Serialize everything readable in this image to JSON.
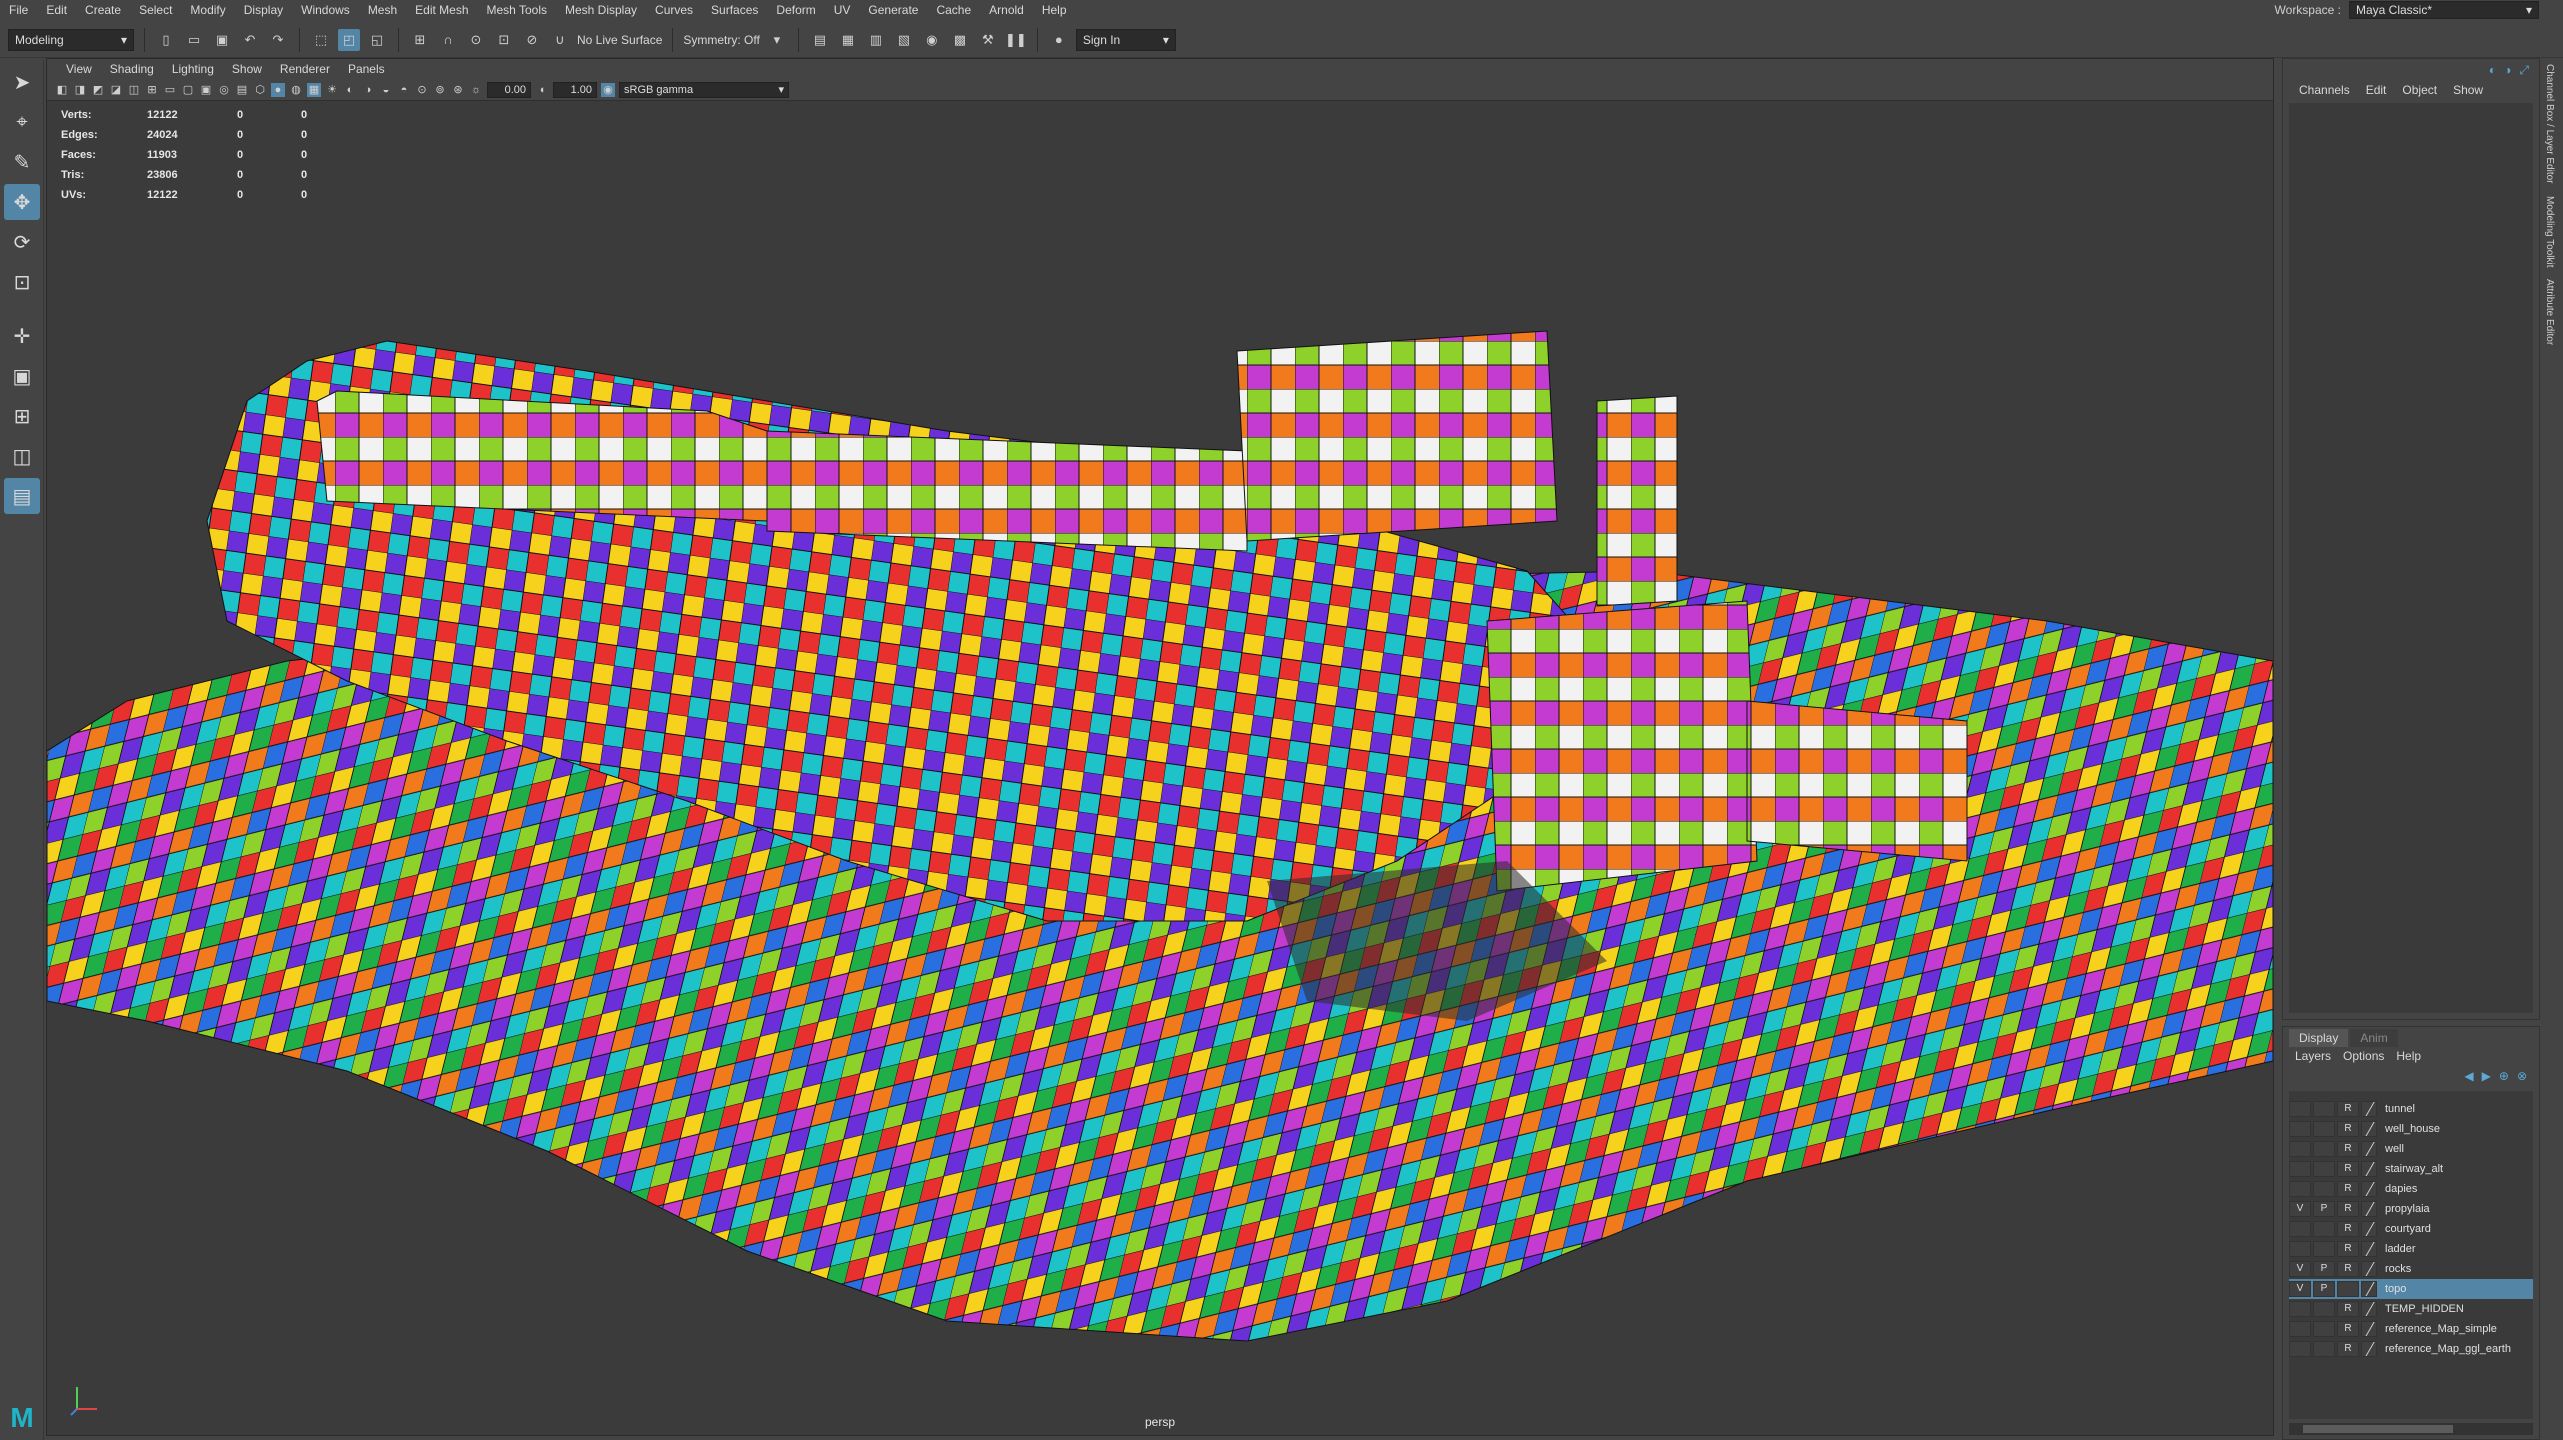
{
  "menubar": {
    "items": [
      "File",
      "Edit",
      "Create",
      "Select",
      "Modify",
      "Display",
      "Windows",
      "Mesh",
      "Edit Mesh",
      "Mesh Tools",
      "Mesh Display",
      "Curves",
      "Surfaces",
      "Deform",
      "UV",
      "Generate",
      "Cache",
      "Arnold",
      "Help"
    ],
    "workspace_label": "Workspace :",
    "workspace_value": "Maya Classic*"
  },
  "statusline": {
    "menuset": "Modeling",
    "live_surface": "No Live Surface",
    "symmetry": "Symmetry: Off",
    "sign_in": "Sign In"
  },
  "viewport": {
    "menu": [
      "View",
      "Shading",
      "Lighting",
      "Show",
      "Renderer",
      "Panels"
    ],
    "exposure": "0.00",
    "gamma": "1.00",
    "color_space": "sRGB gamma",
    "camera": "persp",
    "hud": [
      {
        "label": "Verts:",
        "value": "12122",
        "a": "0",
        "b": "0"
      },
      {
        "label": "Edges:",
        "value": "24024",
        "a": "0",
        "b": "0"
      },
      {
        "label": "Faces:",
        "value": "11903",
        "a": "0",
        "b": "0"
      },
      {
        "label": "Tris:",
        "value": "23806",
        "a": "0",
        "b": "0"
      },
      {
        "label": "UVs:",
        "value": "12122",
        "a": "0",
        "b": "0"
      }
    ]
  },
  "channelbox": {
    "menu": [
      "Channels",
      "Edit",
      "Object",
      "Show"
    ]
  },
  "side_tabs": [
    "Channel Box / Layer Editor",
    "Modeling Toolkit",
    "Attribute Editor"
  ],
  "layer_editor": {
    "tabs": [
      "Display",
      "Anim"
    ],
    "menu": [
      "Layers",
      "Options",
      "Help"
    ],
    "layers": [
      {
        "v": "",
        "p": "",
        "r": "R",
        "name": "tunnel",
        "selected": false
      },
      {
        "v": "",
        "p": "",
        "r": "R",
        "name": "well_house",
        "selected": false
      },
      {
        "v": "",
        "p": "",
        "r": "R",
        "name": "well",
        "selected": false
      },
      {
        "v": "",
        "p": "",
        "r": "R",
        "name": "stairway_alt",
        "selected": false
      },
      {
        "v": "",
        "p": "",
        "r": "R",
        "name": "dapies",
        "selected": false
      },
      {
        "v": "V",
        "p": "P",
        "r": "R",
        "name": "propylaia",
        "selected": false
      },
      {
        "v": "",
        "p": "",
        "r": "R",
        "name": "courtyard",
        "selected": false
      },
      {
        "v": "",
        "p": "",
        "r": "R",
        "name": "ladder",
        "selected": false
      },
      {
        "v": "V",
        "p": "P",
        "r": "R",
        "name": "rocks",
        "selected": false
      },
      {
        "v": "V",
        "p": "P",
        "r": "",
        "name": "topo",
        "selected": true
      },
      {
        "v": "",
        "p": "",
        "r": "R",
        "name": "TEMP_HIDDEN",
        "selected": false
      },
      {
        "v": "",
        "p": "",
        "r": "R",
        "name": "reference_Map_simple",
        "selected": false
      },
      {
        "v": "",
        "p": "",
        "r": "R",
        "name": "reference_Map_ggl_earth",
        "selected": false
      }
    ]
  },
  "colors": {
    "ui_bg": "#444444",
    "accent": "#5285a6",
    "viewport_bg": "#3b3b3b",
    "checker": [
      "#e8302f",
      "#f07a1c",
      "#f6d21c",
      "#8fd12b",
      "#1fae48",
      "#1ec3c9",
      "#2a6fe0",
      "#6a2fd8",
      "#c43bd1",
      "#f2f2f2"
    ]
  },
  "logo": "M"
}
